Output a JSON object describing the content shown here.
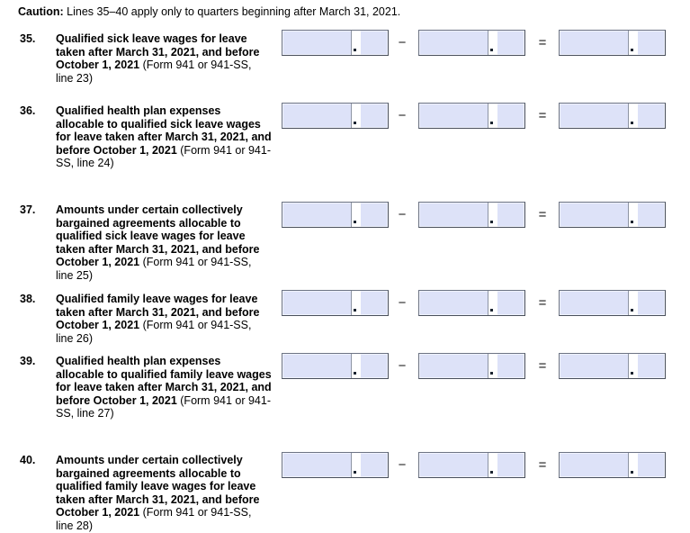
{
  "caution": {
    "lead": "Caution:",
    "text": " Lines 35–40 apply only to quarters beginning after March 31, 2021."
  },
  "operators": {
    "minus": "−",
    "equals": "=",
    "decimal_point": "."
  },
  "lines": [
    {
      "number": "35.",
      "bold_text": "Qualified sick leave wages for leave taken after March 31, 2021, and before October 1, 2021 ",
      "normal_text": "(Form 941 or 941-SS, line 23)",
      "box1_value": "",
      "box2_value": "",
      "box3_value": ""
    },
    {
      "number": "36.",
      "bold_text": "Qualified health plan expenses allocable to qualified sick leave wages for leave taken after March 31, 2021, and before October 1, 2021 ",
      "normal_text": "(Form 941 or 941-SS, line 24)",
      "box1_value": "",
      "box2_value": "",
      "box3_value": ""
    },
    {
      "number": "37.",
      "bold_text": "Amounts under certain collectively bargained agreements allocable to qualified sick leave wages for leave taken after March 31, 2021, and before October 1, 2021 ",
      "normal_text": "(Form 941 or 941-SS, line 25)",
      "box1_value": "",
      "box2_value": "",
      "box3_value": ""
    },
    {
      "number": "38.",
      "bold_text": "Qualified family leave wages for leave taken after March 31, 2021, and before October 1, 2021 ",
      "normal_text": "(Form 941 or 941-SS, line 26)",
      "box1_value": "",
      "box2_value": "",
      "box3_value": ""
    },
    {
      "number": "39.",
      "bold_text": "Qualified health plan expenses allocable to qualified family leave wages for leave taken after March 31, 2021, and before October 1, 2021 ",
      "normal_text": "(Form 941 or 941-SS, line 27)",
      "box1_value": "",
      "box2_value": "",
      "box3_value": ""
    },
    {
      "number": "40.",
      "bold_text": "Amounts under certain collectively bargained agreements allocable to qualified family leave wages for leave taken after March 31, 2021, and before October 1, 2021 ",
      "normal_text": "(Form 941 or 941-SS, line 28)",
      "box1_value": "",
      "box2_value": "",
      "box3_value": ""
    }
  ],
  "layout": {
    "row_tops": [
      33,
      114,
      224,
      322,
      392,
      502
    ],
    "text_tops": [
      36,
      116,
      226,
      325,
      394,
      504
    ]
  },
  "colors": {
    "box_fill": "#dde2f8",
    "box_border": "#5d6472",
    "decimal_strip": "#ffffff",
    "text": "#000000"
  }
}
